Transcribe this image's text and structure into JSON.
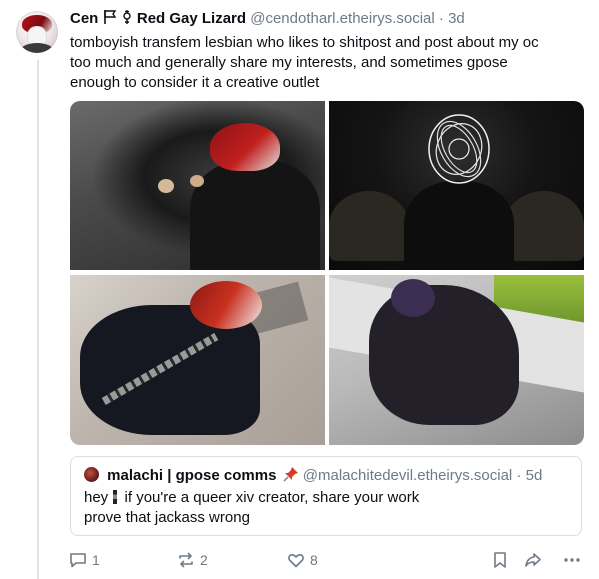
{
  "post": {
    "display_name": "Cen",
    "display_name_suffix": "Red Gay Lizard",
    "handle": "@cendotharl.etheirys.social",
    "separator": "·",
    "time": "3d",
    "text_lines": [
      "tomboyish transfem lesbian who likes to shitpost and post about my oc",
      "too much and generally share my interests, and sometimes gpose",
      "enough to consider it a creative outlet"
    ],
    "images": [
      {
        "name": "gpose-image-1"
      },
      {
        "name": "gpose-image-2"
      },
      {
        "name": "gpose-image-3"
      },
      {
        "name": "gpose-image-4"
      }
    ]
  },
  "quote": {
    "display_name": "malachi | gpose comms",
    "handle": "@malachitedevil.etheirys.social",
    "separator": "·",
    "time": "5d",
    "line1_before_flag": "hey",
    "line1_after_flag": "if you're a queer xiv creator, share your work",
    "line2": "prove that jackass wrong"
  },
  "actions": {
    "reply_count": "1",
    "repost_count": "2",
    "like_count": "8"
  },
  "icons": {
    "flag": "flag-icon",
    "symbol": "transgender-symbol-icon",
    "pin": "pin-icon",
    "reply": "reply-icon",
    "repost": "repost-icon",
    "like": "heart-icon",
    "bookmark": "bookmark-icon",
    "share": "share-icon",
    "more": "more-icon"
  },
  "colors": {
    "text": "#0b0f14",
    "muted": "#6f7a86",
    "border": "#d9dee3",
    "pin": "#d83b2b"
  }
}
